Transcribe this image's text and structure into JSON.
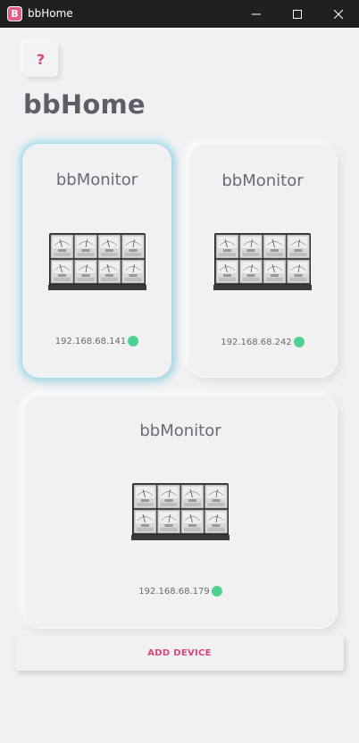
{
  "window": {
    "app_icon_letter": "B",
    "title": "bbHome"
  },
  "header": {
    "help_label": "?",
    "page_title": "bbHome"
  },
  "devices": [
    {
      "name": "bbMonitor",
      "ip": "192.168.68.141",
      "status": "online",
      "selected": true
    },
    {
      "name": "bbMonitor",
      "ip": "192.168.68.242",
      "status": "online",
      "selected": false
    },
    {
      "name": "bbMonitor",
      "ip": "192.168.68.179",
      "status": "online",
      "selected": false
    }
  ],
  "actions": {
    "add_device_label": "ADD DEVICE"
  },
  "colors": {
    "accent": "#d9467a",
    "status_online": "#4fd18f",
    "selected_glow": "#6ecde1",
    "titlebar": "#202020",
    "background": "#f1f1f4"
  },
  "icons": {
    "minimize": "minimize-icon",
    "maximize": "maximize-icon",
    "close": "close-icon",
    "app": "app-icon"
  }
}
